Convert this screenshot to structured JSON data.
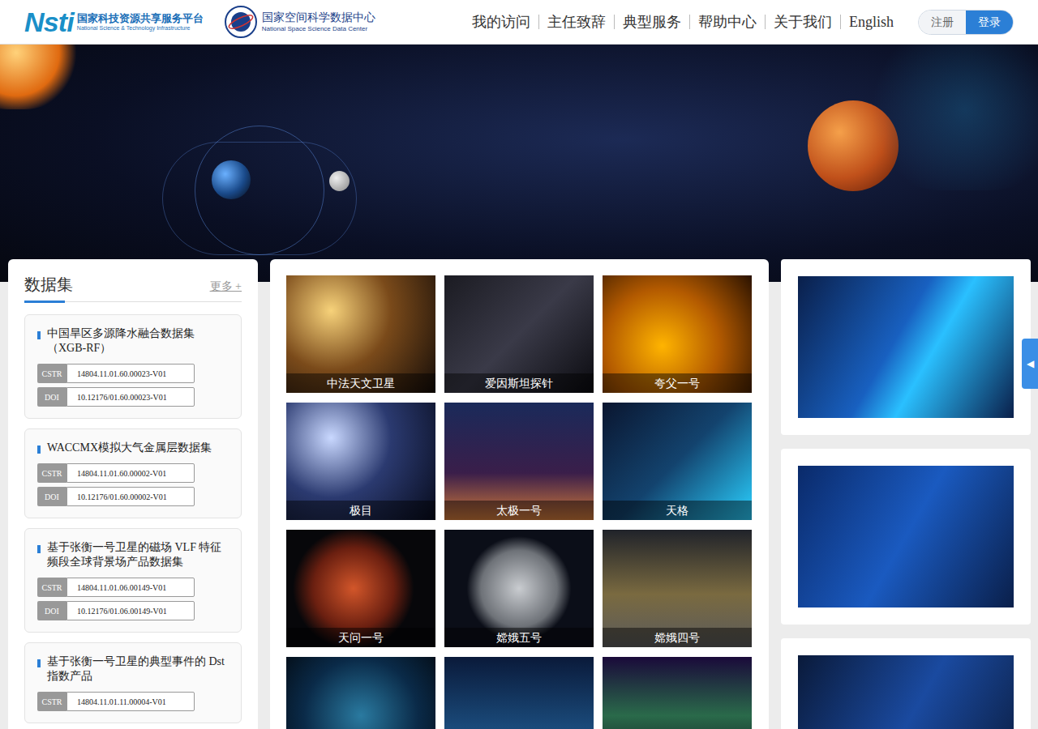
{
  "header": {
    "platform_logo": {
      "mark": "Nsti",
      "title": "国家科技资源共享服务平台",
      "subtitle": "National Science & Technology Infrastructure"
    },
    "center_logo": {
      "title": "国家空间科学数据中心",
      "subtitle": "National Space Science Data Center"
    },
    "nav": [
      "我的访问",
      "主任致辞",
      "典型服务",
      "帮助中心",
      "关于我们",
      "English"
    ],
    "register": "注册",
    "login": "登录"
  },
  "datasets": {
    "title": "数据集",
    "more": "更多 +",
    "items": [
      {
        "title": "中国旱区多源降水融合数据集（XGB-RF）",
        "codes": [
          {
            "label": "CSTR",
            "value": "14804.11.01.60.00023-V01"
          },
          {
            "label": "DOI",
            "value": "10.12176/01.60.00023-V01"
          }
        ]
      },
      {
        "title": "WACCMX模拟大气金属层数据集",
        "codes": [
          {
            "label": "CSTR",
            "value": "14804.11.01.60.00002-V01"
          },
          {
            "label": "DOI",
            "value": "10.12176/01.60.00002-V01"
          }
        ]
      },
      {
        "title": "基于张衡一号卫星的磁场 VLF 特征频段全球背景场产品数据集",
        "codes": [
          {
            "label": "CSTR",
            "value": "14804.11.01.06.00149-V01"
          },
          {
            "label": "DOI",
            "value": "10.12176/01.06.00149-V01"
          }
        ]
      },
      {
        "title": "基于张衡一号卫星的典型事件的 Dst 指数产品",
        "codes": [
          {
            "label": "CSTR",
            "value": "14804.11.01.11.00004-V01"
          }
        ]
      }
    ]
  },
  "missions": [
    {
      "label": "中法天文卫星"
    },
    {
      "label": "爱因斯坦探针"
    },
    {
      "label": "夸父一号"
    },
    {
      "label": "极目"
    },
    {
      "label": "太极一号"
    },
    {
      "label": "天格"
    },
    {
      "label": "天问一号"
    },
    {
      "label": "嫦娥五号"
    },
    {
      "label": "嫦娥四号"
    },
    {
      "label": null
    },
    {
      "label": null
    },
    {
      "label": null
    }
  ],
  "side_tab": {
    "icon": "◀"
  }
}
